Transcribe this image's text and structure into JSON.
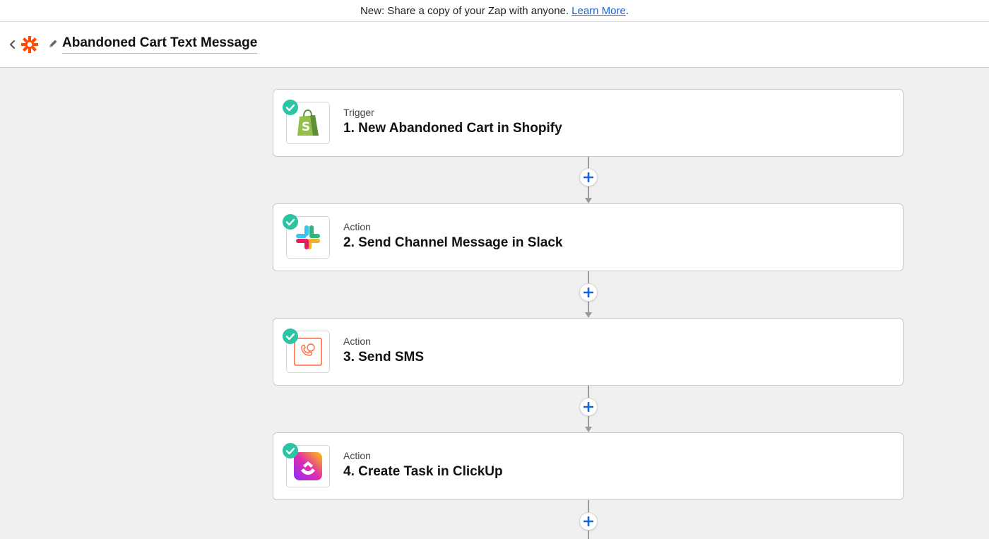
{
  "banner": {
    "text": "New: Share a copy of your Zap with anyone.",
    "link": "Learn More",
    "after_link": "."
  },
  "header": {
    "title": "Abandoned Cart Text Message",
    "icons": [
      "chevron-left-icon",
      "zapier-logo-icon",
      "pencil-icon"
    ]
  },
  "colors": {
    "check": "#2bc4a4",
    "plus": "#1565d8",
    "zapier_orange": "#ff4a00",
    "link": "#1565d8"
  },
  "steps": [
    {
      "type": "Trigger",
      "name": "1. New Abandoned Cart in Shopify",
      "app_icon": "shopify-icon",
      "status_icon": "check-icon"
    },
    {
      "type": "Action",
      "name": "2. Send Channel Message in Slack",
      "app_icon": "slack-icon",
      "status_icon": "check-icon"
    },
    {
      "type": "Action",
      "name": "3. Send SMS",
      "app_icon": "sms-icon",
      "status_icon": "check-icon"
    },
    {
      "type": "Action",
      "name": "4. Create Task in ClickUp",
      "app_icon": "clickup-icon",
      "status_icon": "check-icon"
    }
  ],
  "add_step_icon": "plus-icon"
}
